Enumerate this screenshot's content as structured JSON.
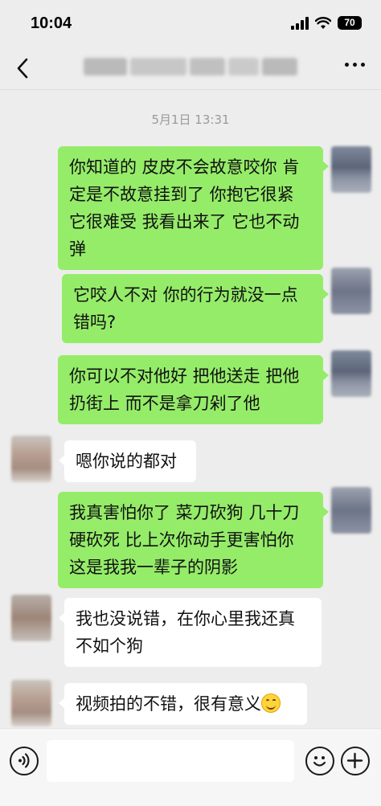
{
  "status_bar": {
    "time": "10:04",
    "battery": "70",
    "icons": [
      "signal-icon",
      "wifi-icon",
      "battery-icon"
    ]
  },
  "header": {
    "back_icon": "chevron-left-icon",
    "more_icon": "ellipsis-icon"
  },
  "chat": {
    "timestamp": "5月1日 13:31",
    "messages": [
      {
        "side": "out",
        "text": "你知道的 皮皮不会故意咬你 肯定是不故意挂到了 你抱它很紧 它很难受 我看出来了 它也不动弹"
      },
      {
        "side": "out",
        "text": "它咬人不对 你的行为就没一点错吗?"
      },
      {
        "side": "out",
        "text": "你可以不对他好 把他送走 把他扔街上 而不是拿刀剁了他"
      },
      {
        "side": "in",
        "text": "嗯你说的都对"
      },
      {
        "side": "out",
        "text": "我真害怕你了 菜刀砍狗 几十刀硬砍死 比上次你动手更害怕你 这是我我一辈子的阴影"
      },
      {
        "side": "in",
        "text": "我也没说错，在你心里我还真不如个狗"
      },
      {
        "side": "in",
        "text": "视频拍的不错，很有意义",
        "emoji": "smile-emoji"
      }
    ]
  },
  "input_bar": {
    "voice_icon": "voice-icon",
    "emoji_icon": "emoji-icon",
    "add_icon": "plus-icon",
    "placeholder": ""
  },
  "colors": {
    "background": "#ededed",
    "outgoing_bubble": "#95ec69",
    "incoming_bubble": "#ffffff",
    "timestamp": "#9a9a9a"
  }
}
